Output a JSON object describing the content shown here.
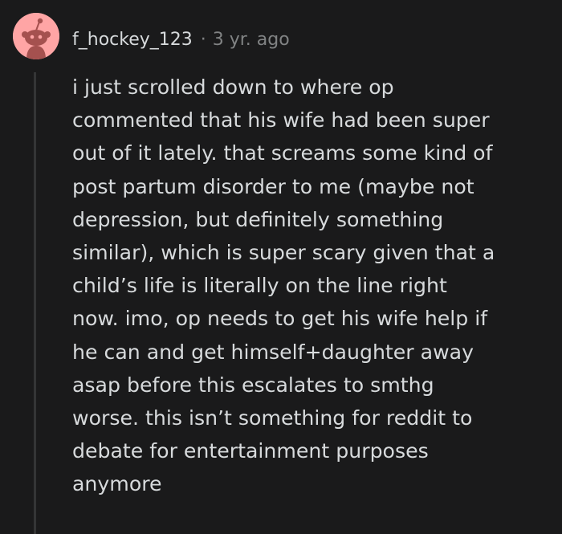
{
  "comment": {
    "username": "f_hockey_123",
    "separator": "·",
    "timestamp": "3 yr. ago",
    "avatar_icon": "reddit-snoo-avatar-icon",
    "avatar_color": "#ffa5a5",
    "lines": [
      "i just scrolled down to where op",
      "commented that his wife had been super",
      "out of it lately. that screams some kind of",
      "post partum disorder to me (maybe not",
      "depression, but definitely something",
      "similar), which is super scary given that a",
      "child’s life is literally on the line right",
      "now. imo, op needs to get his wife help if",
      "he can and get himself+daughter away",
      "asap before this escalates to smthg",
      "worse. this isn’t something for reddit to",
      "debate for entertainment purposes",
      "anymore"
    ]
  },
  "colors": {
    "background": "#1a1a1b",
    "text": "#d7dadc",
    "meta": "#818384",
    "thread_line": "#343536"
  }
}
